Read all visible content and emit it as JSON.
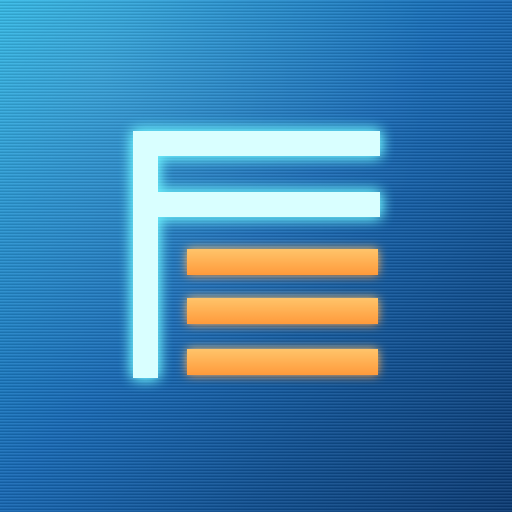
{
  "icon": {
    "name": "document-list-icon",
    "colors": {
      "background_light": "#27b6e6",
      "background_dark": "#0a3a74",
      "frame": "#d9ffff",
      "frame_glow": "#6ff6ff",
      "line_fill": "#ffb24d",
      "line_glow": "#ff7a1a"
    }
  }
}
